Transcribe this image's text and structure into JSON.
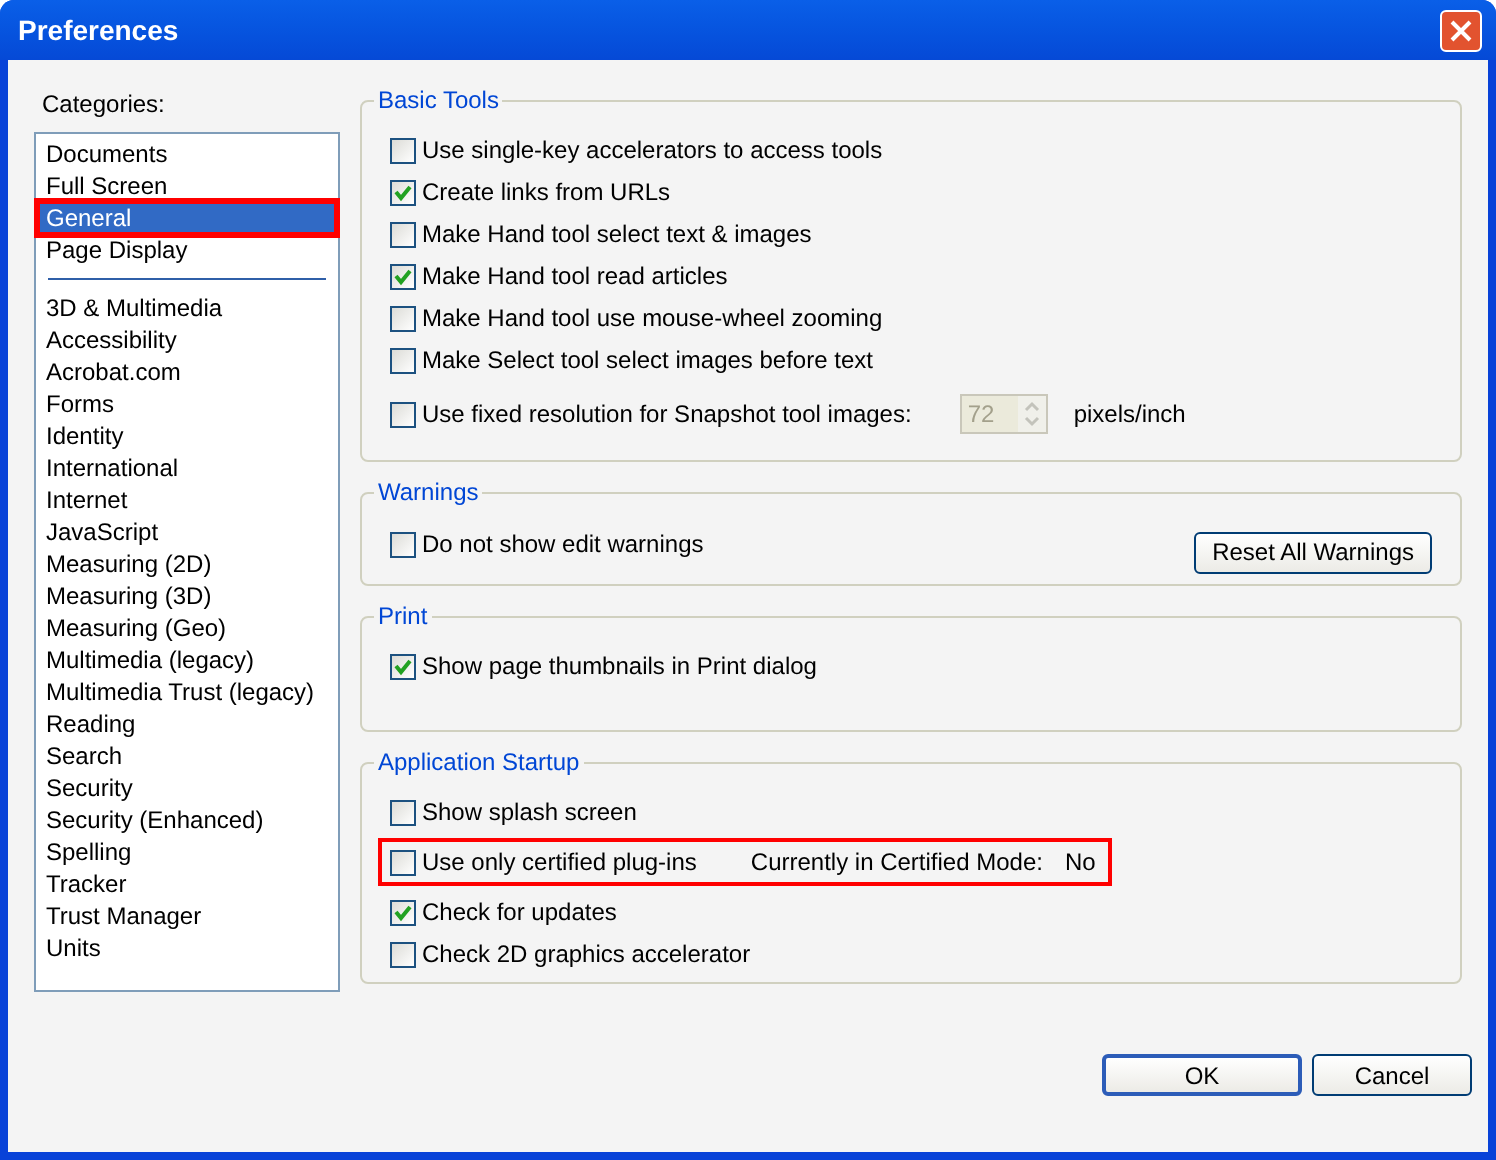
{
  "window": {
    "title": "Preferences"
  },
  "categories": {
    "label": "Categories:",
    "groups": [
      [
        {
          "label": "Documents",
          "selected": false,
          "highlighted": false
        },
        {
          "label": "Full Screen",
          "selected": false,
          "highlighted": false
        },
        {
          "label": "General",
          "selected": true,
          "highlighted": true
        },
        {
          "label": "Page Display",
          "selected": false,
          "highlighted": false
        }
      ],
      [
        {
          "label": "3D & Multimedia",
          "selected": false,
          "highlighted": false
        },
        {
          "label": "Accessibility",
          "selected": false,
          "highlighted": false
        },
        {
          "label": "Acrobat.com",
          "selected": false,
          "highlighted": false
        },
        {
          "label": "Forms",
          "selected": false,
          "highlighted": false
        },
        {
          "label": "Identity",
          "selected": false,
          "highlighted": false
        },
        {
          "label": "International",
          "selected": false,
          "highlighted": false
        },
        {
          "label": "Internet",
          "selected": false,
          "highlighted": false
        },
        {
          "label": "JavaScript",
          "selected": false,
          "highlighted": false
        },
        {
          "label": "Measuring (2D)",
          "selected": false,
          "highlighted": false
        },
        {
          "label": "Measuring (3D)",
          "selected": false,
          "highlighted": false
        },
        {
          "label": "Measuring (Geo)",
          "selected": false,
          "highlighted": false
        },
        {
          "label": "Multimedia (legacy)",
          "selected": false,
          "highlighted": false
        },
        {
          "label": "Multimedia Trust (legacy)",
          "selected": false,
          "highlighted": false
        },
        {
          "label": "Reading",
          "selected": false,
          "highlighted": false
        },
        {
          "label": "Search",
          "selected": false,
          "highlighted": false
        },
        {
          "label": "Security",
          "selected": false,
          "highlighted": false
        },
        {
          "label": "Security (Enhanced)",
          "selected": false,
          "highlighted": false
        },
        {
          "label": "Spelling",
          "selected": false,
          "highlighted": false
        },
        {
          "label": "Tracker",
          "selected": false,
          "highlighted": false
        },
        {
          "label": "Trust Manager",
          "selected": false,
          "highlighted": false
        },
        {
          "label": "Units",
          "selected": false,
          "highlighted": false
        }
      ]
    ]
  },
  "groups": [
    {
      "title": "Basic Tools",
      "options": [
        {
          "kind": "checkbox",
          "label": "Use single-key accelerators to access tools",
          "checked": false
        },
        {
          "kind": "checkbox",
          "label": "Create links from URLs",
          "checked": true
        },
        {
          "kind": "checkbox",
          "label": "Make Hand tool select text & images",
          "checked": false
        },
        {
          "kind": "checkbox",
          "label": "Make Hand tool read articles",
          "checked": true
        },
        {
          "kind": "checkbox",
          "label": "Make Hand tool use mouse-wheel zooming",
          "checked": false
        },
        {
          "kind": "checkbox",
          "label": "Make Select tool select images before text",
          "checked": false
        },
        {
          "kind": "spin",
          "label": "Use fixed resolution for Snapshot tool images:",
          "checked": false,
          "value": "72",
          "disabled": true,
          "unit": "pixels/inch"
        }
      ]
    },
    {
      "title": "Warnings",
      "options": [
        {
          "kind": "button_row",
          "label": "Do not show edit warnings",
          "checked": false,
          "button": "Reset All Warnings"
        }
      ]
    },
    {
      "title": "Print",
      "options": [
        {
          "kind": "checkbox",
          "label": "Show page thumbnails in Print dialog",
          "checked": true
        }
      ]
    },
    {
      "title": "Application Startup",
      "options": [
        {
          "kind": "checkbox",
          "label": "Show splash screen",
          "checked": false
        },
        {
          "kind": "status",
          "label": "Use only certified plug-ins",
          "checked": false,
          "status_label": "Currently in Certified Mode:",
          "status_value": "No",
          "highlighted": true
        },
        {
          "kind": "checkbox",
          "label": "Check for updates",
          "checked": true
        },
        {
          "kind": "checkbox",
          "label": "Check 2D graphics accelerator",
          "checked": false
        }
      ]
    }
  ],
  "buttons": [
    "OK",
    "Cancel"
  ]
}
